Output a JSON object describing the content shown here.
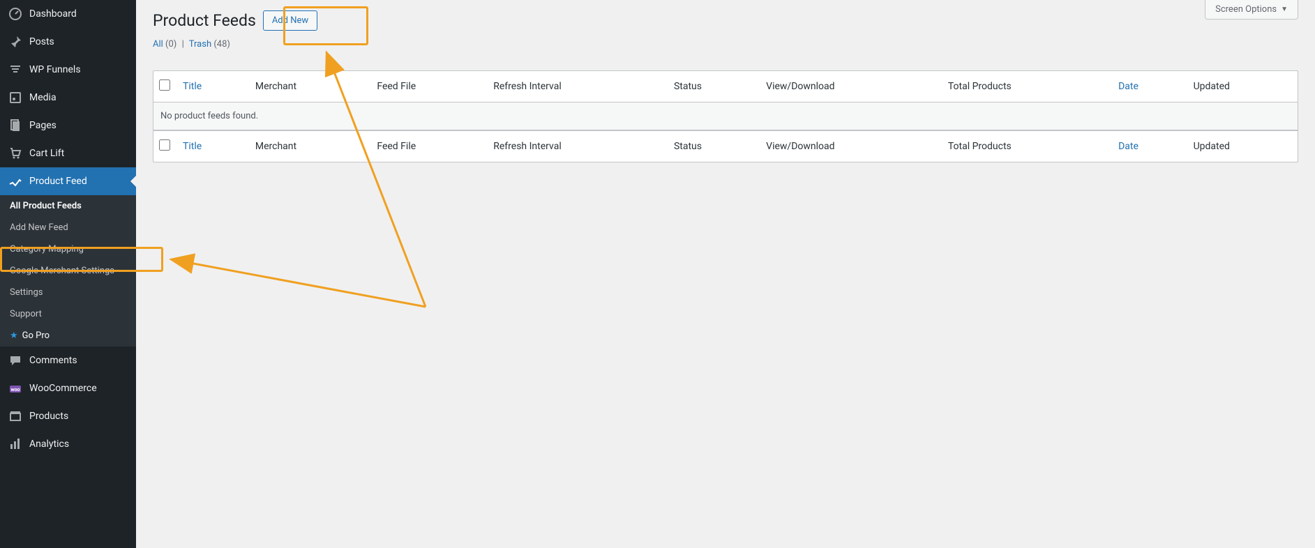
{
  "sidebar": {
    "items": [
      {
        "label": "Dashboard"
      },
      {
        "label": "Posts"
      },
      {
        "label": "WP Funnels"
      },
      {
        "label": "Media"
      },
      {
        "label": "Pages"
      },
      {
        "label": "Cart Lift"
      },
      {
        "label": "Product Feed"
      },
      {
        "label": "Comments"
      },
      {
        "label": "WooCommerce"
      },
      {
        "label": "Products"
      },
      {
        "label": "Analytics"
      }
    ],
    "submenu": [
      {
        "label": "All Product Feeds"
      },
      {
        "label": "Add New Feed"
      },
      {
        "label": "Category Mapping"
      },
      {
        "label": "Google Merchant Settings"
      },
      {
        "label": "Settings"
      },
      {
        "label": "Support"
      },
      {
        "label": "Go Pro"
      }
    ]
  },
  "page": {
    "title": "Product Feeds",
    "add_new": "Add New",
    "screen_options": "Screen Options",
    "subsubsub": {
      "all_label": "All",
      "all_count": "(0)",
      "trash_label": "Trash",
      "trash_count": "(48)"
    }
  },
  "table": {
    "columns": {
      "title": "Title",
      "merchant": "Merchant",
      "feed_file": "Feed File",
      "refresh_interval": "Refresh Interval",
      "status": "Status",
      "view_download": "View/Download",
      "total_products": "Total Products",
      "date": "Date",
      "updated": "Updated"
    },
    "empty_message": "No product feeds found."
  }
}
